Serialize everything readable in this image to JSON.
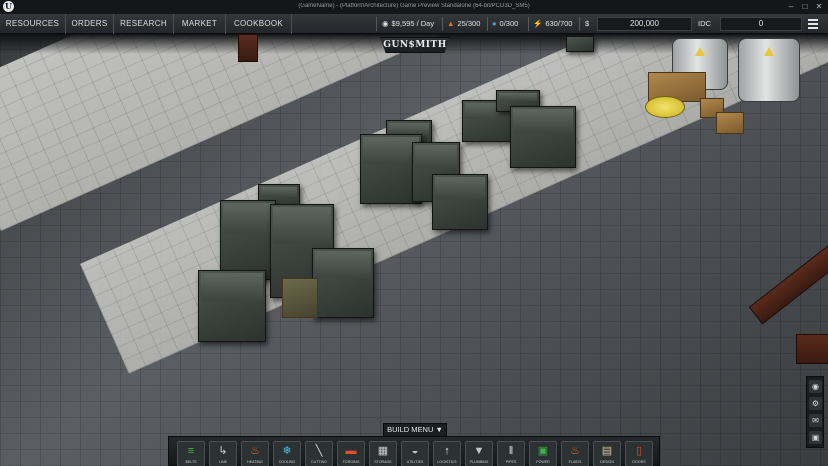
{
  "window": {
    "title": "(GameName) - (PlatformArchitecture) Game Preview Standalone (64-bit/PCD3D_SM5)"
  },
  "nav": {
    "items": [
      "RESOURCES",
      "ORDERS",
      "RESEARCH",
      "MARKET",
      "COOKBOOK"
    ]
  },
  "stats": {
    "income": "$9,595 / Day",
    "fuel": "25/300",
    "water": "0/300",
    "power": "630/700",
    "money_symbol": "$",
    "money": "200,000",
    "idc_label": "IDC",
    "idc_value": "0"
  },
  "logo": "GUN$MITH",
  "build_menu": {
    "label": "BUILD MENU ▼",
    "items": [
      {
        "icon": "conveyor-icon",
        "label": "BELTS",
        "color": "#3fb04a"
      },
      {
        "icon": "line-icon",
        "label": "LINE",
        "color": "#cfcfcf"
      },
      {
        "icon": "fire-icon",
        "label": "HEATING",
        "color": "#e8722a"
      },
      {
        "icon": "snowflake-icon",
        "label": "COOLING",
        "color": "#4fc1e8"
      },
      {
        "icon": "blade-icon",
        "label": "CUTTING",
        "color": "#dcdcdc"
      },
      {
        "icon": "forge-icon",
        "label": "FORGING",
        "color": "#e0502c"
      },
      {
        "icon": "storage-icon",
        "label": "STORAGE",
        "color": "#cfcfcf"
      },
      {
        "icon": "helmet-icon",
        "label": "UTILITIES",
        "color": "#c8c8c8"
      },
      {
        "icon": "merge-icon",
        "label": "LOGISTICS",
        "color": "#e8e8e8"
      },
      {
        "icon": "drop-icon",
        "label": "PLUMBING",
        "color": "#c8c8c8"
      },
      {
        "icon": "pipe-icon",
        "label": "PIPES",
        "color": "#e0e0e0"
      },
      {
        "icon": "circuit-icon",
        "label": "POWER",
        "color": "#3fb04a"
      },
      {
        "icon": "fire-water-icon",
        "label": "FLUIDS",
        "color": "#e8722a"
      },
      {
        "icon": "paper-icon",
        "label": "DESIGN",
        "color": "#d8c79a"
      },
      {
        "icon": "door-icon",
        "label": "DOORS",
        "color": "#e0502c"
      }
    ]
  },
  "side_tools": [
    {
      "icon": "eye-icon"
    },
    {
      "icon": "gear-icon"
    },
    {
      "icon": "chat-icon"
    },
    {
      "icon": "camera-icon"
    }
  ],
  "colors": {
    "hud_bg": "#2a2d31",
    "floor_light": "#cfcfcb",
    "floor_dark": "#4a4e52",
    "crate": "#3a423d"
  }
}
